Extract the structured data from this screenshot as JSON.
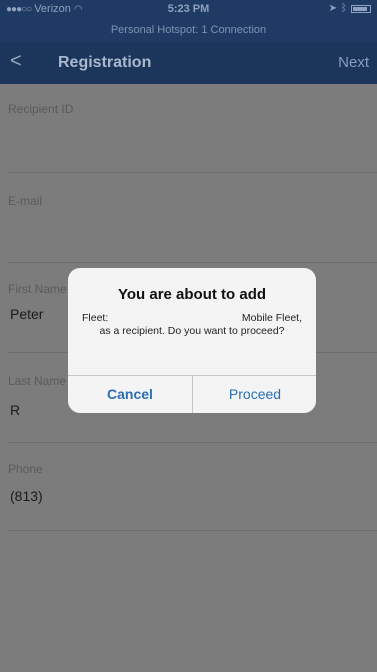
{
  "status_bar": {
    "carrier": "Verizon",
    "time": "5:23 PM",
    "hotspot": "Personal Hotspot: 1 Connection"
  },
  "nav": {
    "back": "<",
    "title": "Registration",
    "next": "Next"
  },
  "form": {
    "recipient_id_label": "Recipient ID",
    "recipient_id_value": "",
    "email_label": "E-mail",
    "email_value": "",
    "first_name_label": "First Name",
    "first_name_value": "Peter",
    "last_name_label": "Last Name",
    "last_name_value": "R",
    "phone_label": "Phone",
    "phone_value": "(813)"
  },
  "dialog": {
    "title": "You are about to add",
    "fleet_label": "Fleet:",
    "fleet_name": "Mobile Fleet,",
    "message_rest": "as a recipient. Do you want to proceed?",
    "cancel": "Cancel",
    "proceed": "Proceed"
  },
  "colors": {
    "nav_background": "#1c355a",
    "dialog_button": "#2a6fb5"
  }
}
